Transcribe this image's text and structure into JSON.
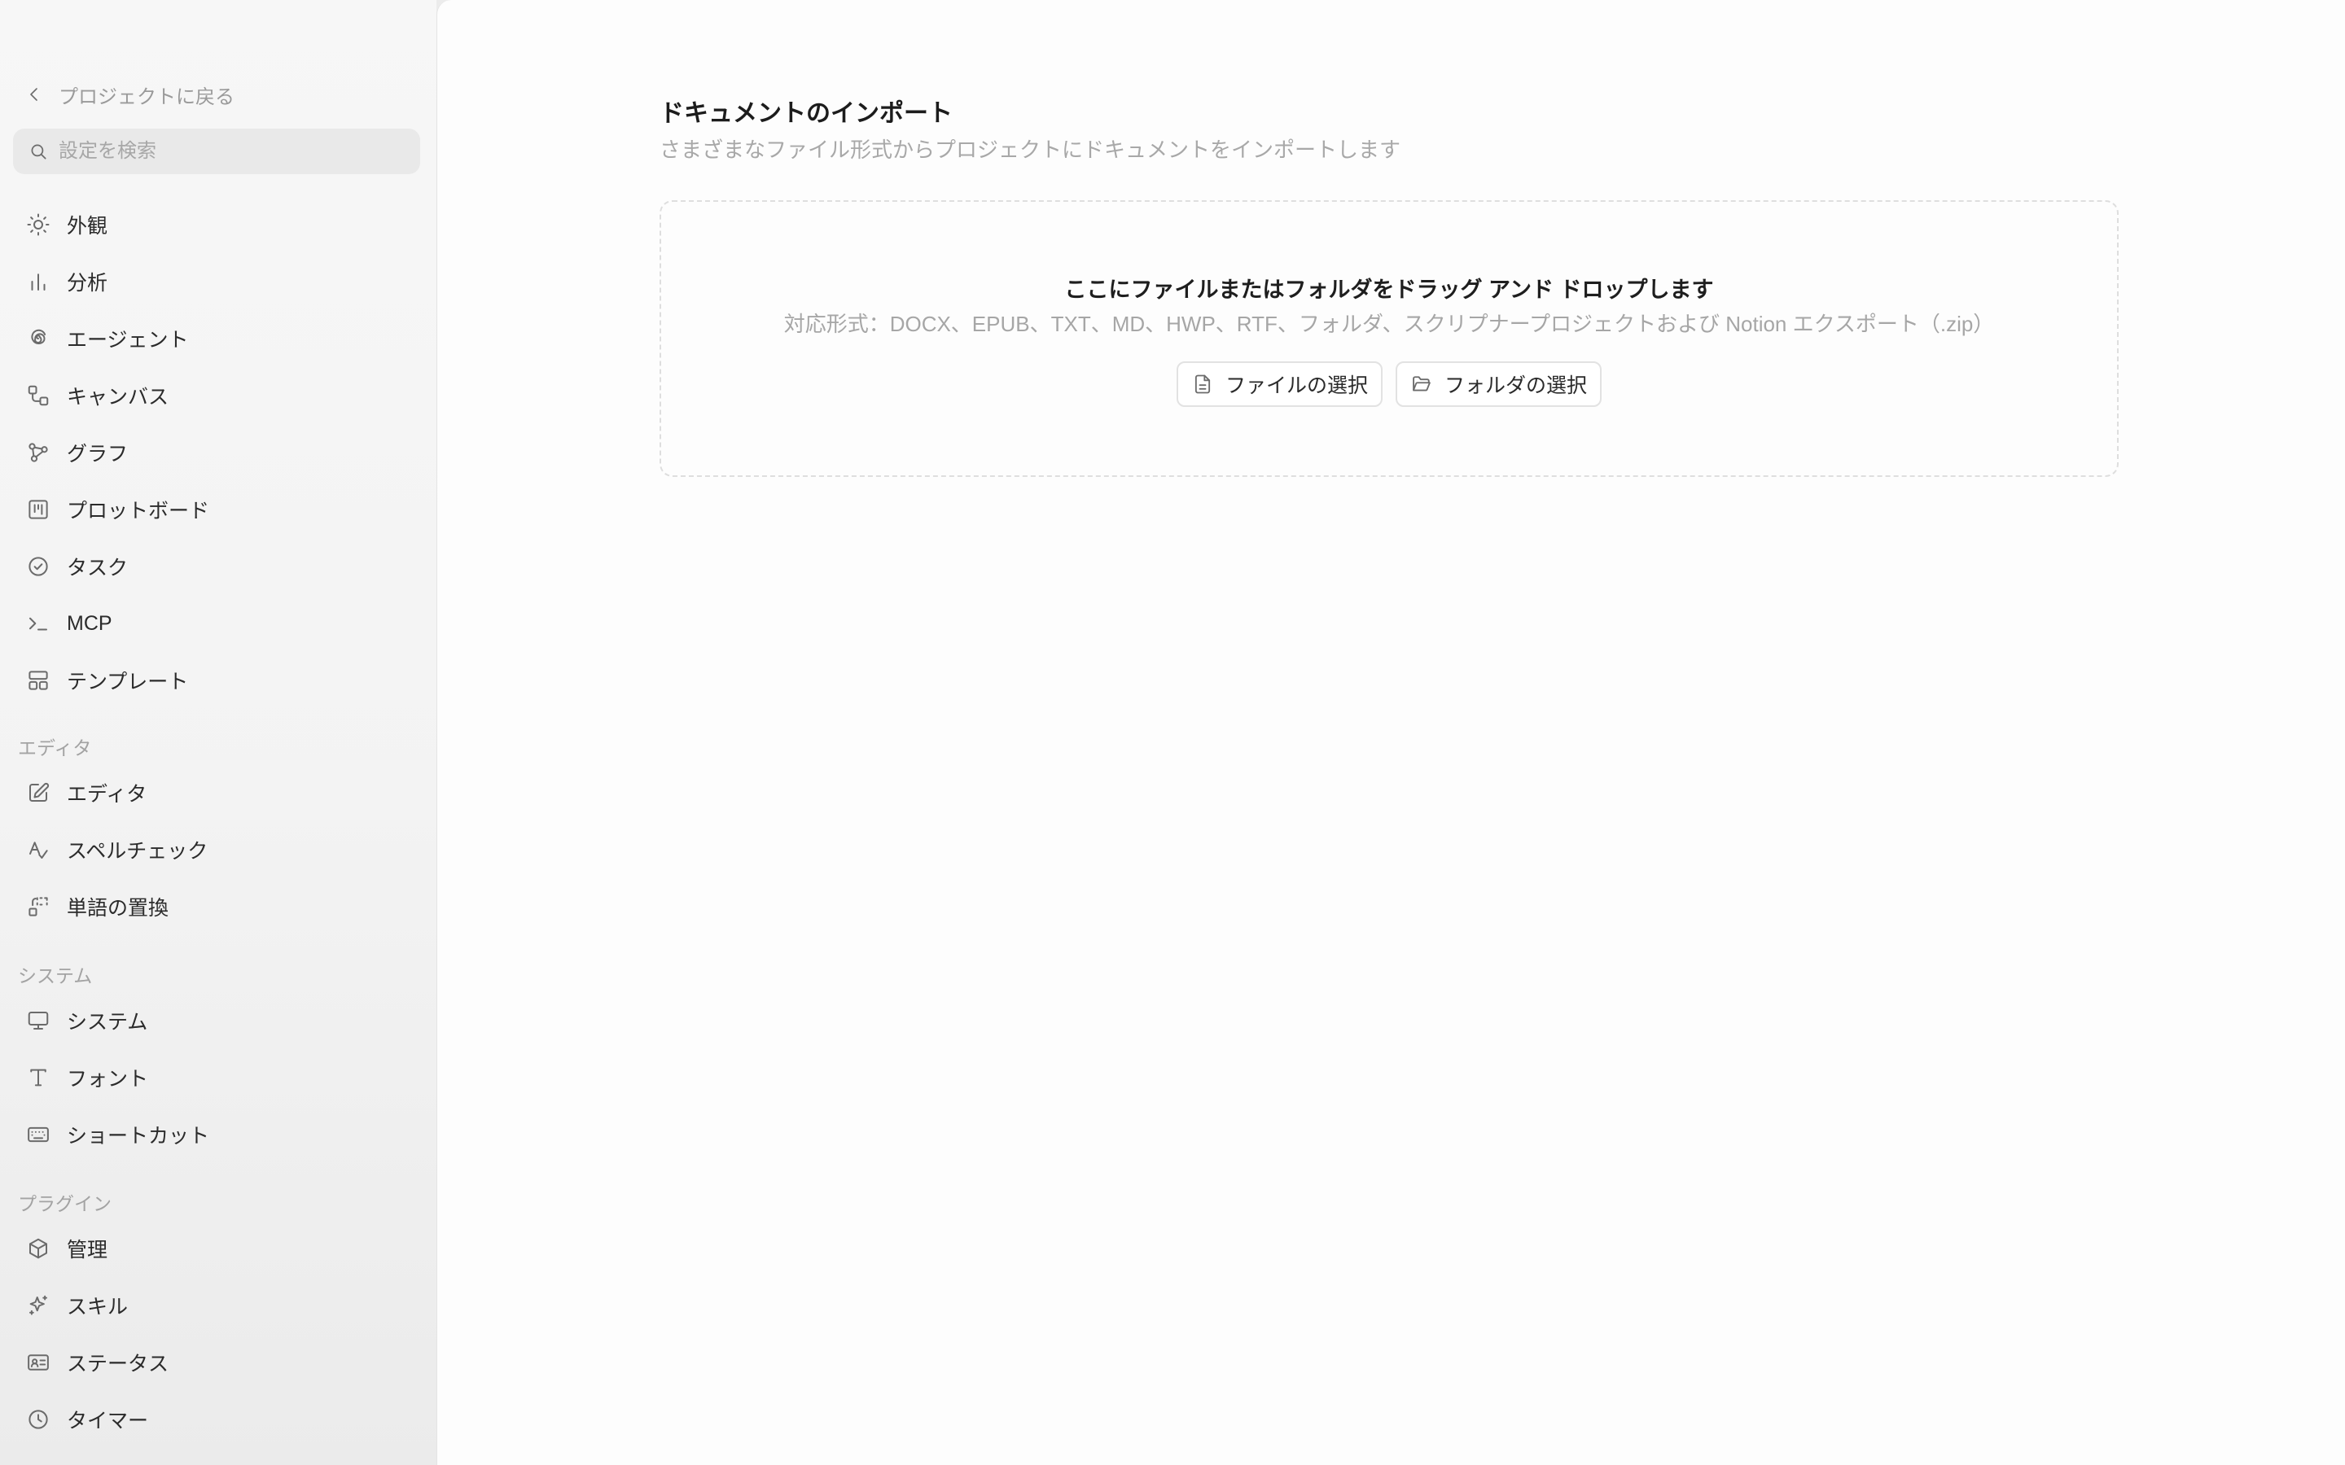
{
  "sidebar": {
    "back_label": "プロジェクトに戻る",
    "search_placeholder": "設定を検索",
    "items": [
      {
        "label": "外観",
        "icon": "sun-icon"
      },
      {
        "label": "分析",
        "icon": "bar-chart-icon"
      },
      {
        "label": "エージェント",
        "icon": "spiral-icon"
      },
      {
        "label": "キャンバス",
        "icon": "canvas-icon"
      },
      {
        "label": "グラフ",
        "icon": "graph-icon"
      },
      {
        "label": "プロットボード",
        "icon": "kanban-icon"
      },
      {
        "label": "タスク",
        "icon": "check-circle-icon"
      },
      {
        "label": "MCP",
        "icon": "terminal-icon"
      },
      {
        "label": "テンプレート",
        "icon": "template-icon"
      }
    ],
    "sections": {
      "editor": {
        "label": "エディタ",
        "items": [
          {
            "label": "エディタ",
            "icon": "edit-icon"
          },
          {
            "label": "スペルチェック",
            "icon": "spellcheck-icon"
          },
          {
            "label": "単語の置換",
            "icon": "replace-icon"
          }
        ]
      },
      "system": {
        "label": "システム",
        "items": [
          {
            "label": "システム",
            "icon": "monitor-icon"
          },
          {
            "label": "フォント",
            "icon": "type-icon"
          },
          {
            "label": "ショートカット",
            "icon": "keyboard-icon"
          }
        ]
      },
      "plugins": {
        "label": "プラグイン",
        "items": [
          {
            "label": "管理",
            "icon": "package-icon"
          },
          {
            "label": "スキル",
            "icon": "sparkle-icon"
          },
          {
            "label": "ステータス",
            "icon": "id-card-icon"
          },
          {
            "label": "タイマー",
            "icon": "clock-icon"
          }
        ]
      }
    }
  },
  "main": {
    "title": "ドキュメントのインポート",
    "subtitle": "さまざまなファイル形式からプロジェクトにドキュメントをインポートします",
    "dropzone": {
      "title": "ここにファイルまたはフォルダをドラッグ アンド ドロップします",
      "formats": "対応形式：DOCX、EPUB、TXT、MD、HWP、RTF、フォルダ、スクリプナープロジェクトおよび Notion エクスポート（.zip）",
      "select_file": "ファイルの選択",
      "select_folder": "フォルダの選択"
    }
  }
}
